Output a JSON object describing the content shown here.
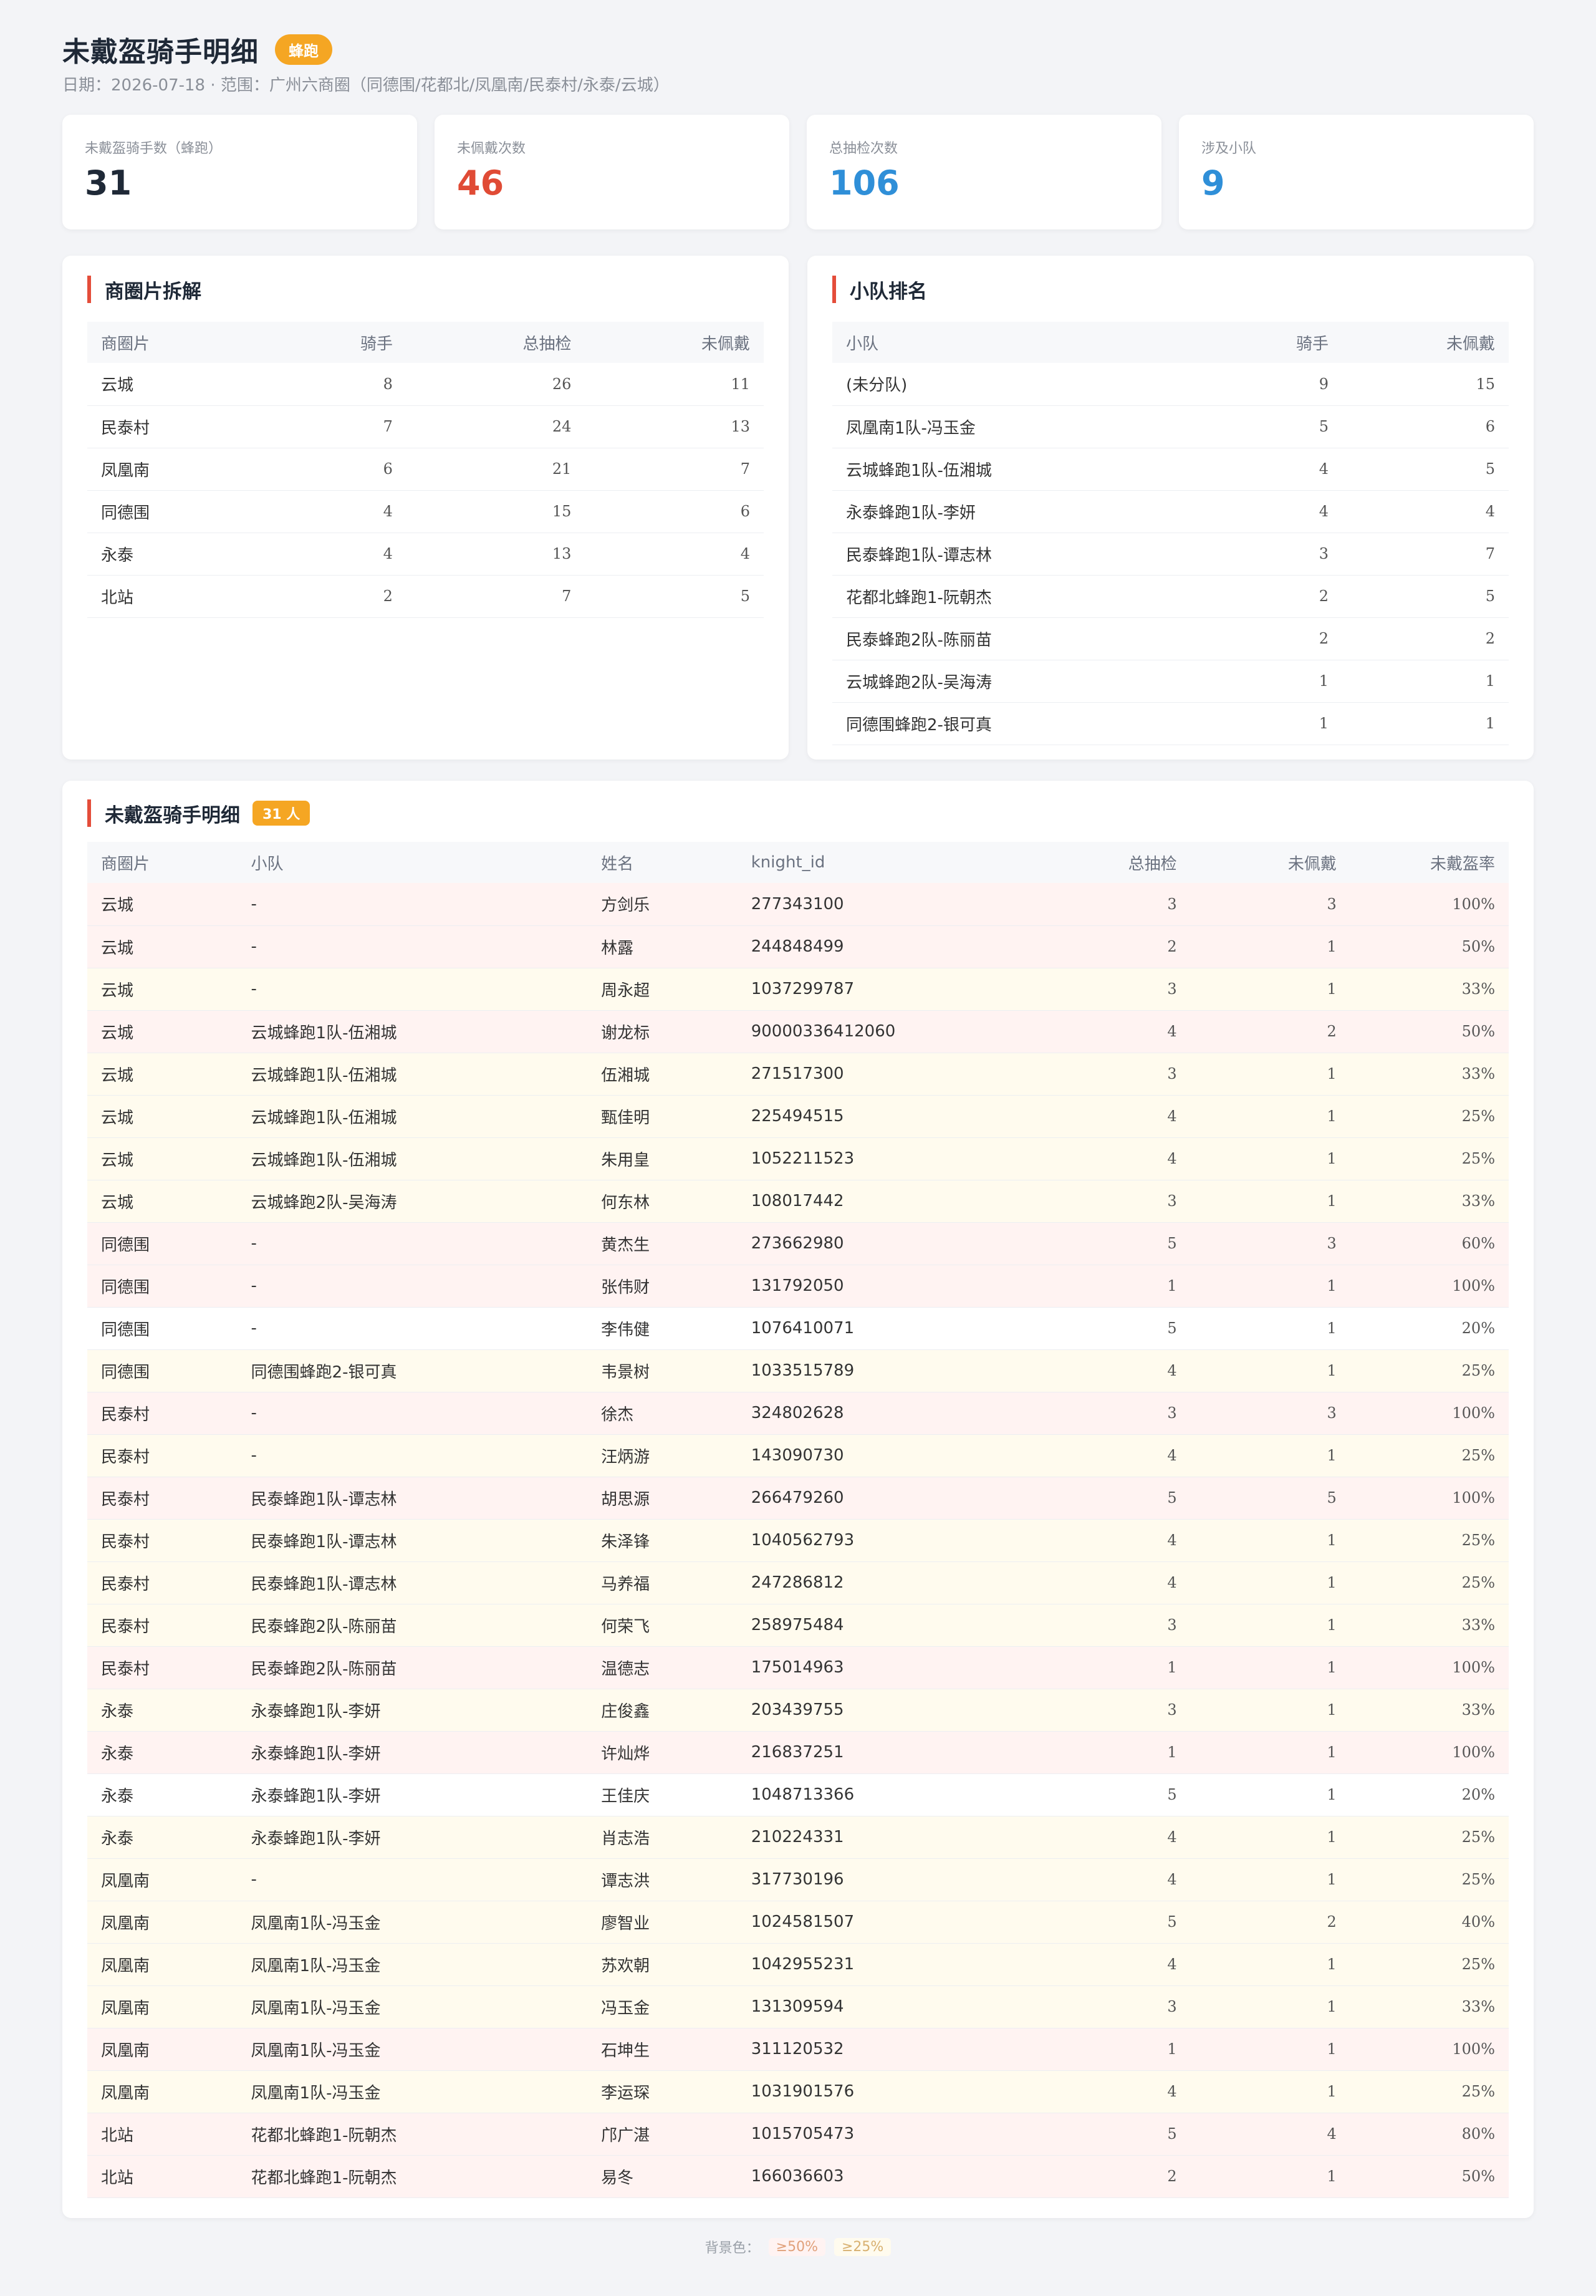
{
  "header": {
    "title": "未戴盔骑手明细",
    "badge": "蜂跑",
    "subtitle": "日期：2026-07-18 · 范围：广州六商圈（同德围/花都北/凤凰南/民泰村/永泰/云城）"
  },
  "stats": [
    {
      "label": "未戴盔骑手数（蜂跑）",
      "value": "31",
      "color": "#1f2937"
    },
    {
      "label": "未佩戴次数",
      "value": "46",
      "color": "#e04b35"
    },
    {
      "label": "总抽检次数",
      "value": "106",
      "color": "#2f8fd8"
    },
    {
      "label": "涉及小队",
      "value": "9",
      "color": "#2f8fd8"
    }
  ],
  "area_breakdown": {
    "title": "商圈片拆解",
    "headers": [
      "商圈片",
      "骑手",
      "总抽检",
      "未佩戴"
    ],
    "rows": [
      [
        "云城",
        "8",
        "26",
        "11"
      ],
      [
        "民泰村",
        "7",
        "24",
        "13"
      ],
      [
        "凤凰南",
        "6",
        "21",
        "7"
      ],
      [
        "同德围",
        "4",
        "15",
        "6"
      ],
      [
        "永泰",
        "4",
        "13",
        "4"
      ],
      [
        "北站",
        "2",
        "7",
        "5"
      ]
    ]
  },
  "team_ranking": {
    "title": "小队排名",
    "headers": [
      "小队",
      "骑手",
      "未佩戴"
    ],
    "rows": [
      [
        "(未分队)",
        "9",
        "15"
      ],
      [
        "凤凰南1队-冯玉金",
        "5",
        "6"
      ],
      [
        "云城蜂跑1队-伍湘城",
        "4",
        "5"
      ],
      [
        "永泰蜂跑1队-李妍",
        "4",
        "4"
      ],
      [
        "民泰蜂跑1队-谭志林",
        "3",
        "7"
      ],
      [
        "花都北蜂跑1-阮朝杰",
        "2",
        "5"
      ],
      [
        "民泰蜂跑2队-陈丽苗",
        "2",
        "2"
      ],
      [
        "云城蜂跑2队-吴海涛",
        "1",
        "1"
      ],
      [
        "同德围蜂跑2-银可真",
        "1",
        "1"
      ]
    ]
  },
  "detail": {
    "title": "未戴盔骑手明细",
    "badge": "31 人",
    "headers": [
      "商圈片",
      "小队",
      "姓名",
      "knight_id",
      "总抽检",
      "未佩戴",
      "未戴盔率"
    ],
    "rows": [
      [
        "云城",
        "-",
        "方剑乐",
        "277343100",
        "3",
        "3",
        "100%"
      ],
      [
        "云城",
        "-",
        "林露",
        "244848499",
        "2",
        "1",
        "50%"
      ],
      [
        "云城",
        "-",
        "周永超",
        "1037299787",
        "3",
        "1",
        "33%"
      ],
      [
        "云城",
        "云城蜂跑1队-伍湘城",
        "谢龙标",
        "90000336412060",
        "4",
        "2",
        "50%"
      ],
      [
        "云城",
        "云城蜂跑1队-伍湘城",
        "伍湘城",
        "271517300",
        "3",
        "1",
        "33%"
      ],
      [
        "云城",
        "云城蜂跑1队-伍湘城",
        "甄佳明",
        "225494515",
        "4",
        "1",
        "25%"
      ],
      [
        "云城",
        "云城蜂跑1队-伍湘城",
        "朱用皇",
        "1052211523",
        "4",
        "1",
        "25%"
      ],
      [
        "云城",
        "云城蜂跑2队-吴海涛",
        "何东林",
        "108017442",
        "3",
        "1",
        "33%"
      ],
      [
        "同德围",
        "-",
        "黄杰生",
        "273662980",
        "5",
        "3",
        "60%"
      ],
      [
        "同德围",
        "-",
        "张伟财",
        "131792050",
        "1",
        "1",
        "100%"
      ],
      [
        "同德围",
        "-",
        "李伟健",
        "1076410071",
        "5",
        "1",
        "20%"
      ],
      [
        "同德围",
        "同德围蜂跑2-银可真",
        "韦景树",
        "1033515789",
        "4",
        "1",
        "25%"
      ],
      [
        "民泰村",
        "-",
        "徐杰",
        "324802628",
        "3",
        "3",
        "100%"
      ],
      [
        "民泰村",
        "-",
        "汪炳游",
        "143090730",
        "4",
        "1",
        "25%"
      ],
      [
        "民泰村",
        "民泰蜂跑1队-谭志林",
        "胡思源",
        "266479260",
        "5",
        "5",
        "100%"
      ],
      [
        "民泰村",
        "民泰蜂跑1队-谭志林",
        "朱泽锋",
        "1040562793",
        "4",
        "1",
        "25%"
      ],
      [
        "民泰村",
        "民泰蜂跑1队-谭志林",
        "马养福",
        "247286812",
        "4",
        "1",
        "25%"
      ],
      [
        "民泰村",
        "民泰蜂跑2队-陈丽苗",
        "何荣飞",
        "258975484",
        "3",
        "1",
        "33%"
      ],
      [
        "民泰村",
        "民泰蜂跑2队-陈丽苗",
        "温德志",
        "175014963",
        "1",
        "1",
        "100%"
      ],
      [
        "永泰",
        "永泰蜂跑1队-李妍",
        "庄俊鑫",
        "203439755",
        "3",
        "1",
        "33%"
      ],
      [
        "永泰",
        "永泰蜂跑1队-李妍",
        "许灿烨",
        "216837251",
        "1",
        "1",
        "100%"
      ],
      [
        "永泰",
        "永泰蜂跑1队-李妍",
        "王佳庆",
        "1048713366",
        "5",
        "1",
        "20%"
      ],
      [
        "永泰",
        "永泰蜂跑1队-李妍",
        "肖志浩",
        "210224331",
        "4",
        "1",
        "25%"
      ],
      [
        "凤凰南",
        "-",
        "谭志洪",
        "317730196",
        "4",
        "1",
        "25%"
      ],
      [
        "凤凰南",
        "凤凰南1队-冯玉金",
        "廖智业",
        "1024581507",
        "5",
        "2",
        "40%"
      ],
      [
        "凤凰南",
        "凤凰南1队-冯玉金",
        "苏欢朝",
        "1042955231",
        "4",
        "1",
        "25%"
      ],
      [
        "凤凰南",
        "凤凰南1队-冯玉金",
        "冯玉金",
        "131309594",
        "3",
        "1",
        "33%"
      ],
      [
        "凤凰南",
        "凤凰南1队-冯玉金",
        "石坤生",
        "311120532",
        "1",
        "1",
        "100%"
      ],
      [
        "凤凰南",
        "凤凰南1队-冯玉金",
        "李运琛",
        "1031901576",
        "4",
        "1",
        "25%"
      ],
      [
        "北站",
        "花都北蜂跑1-阮朝杰",
        "邝广湛",
        "1015705473",
        "5",
        "4",
        "80%"
      ],
      [
        "北站",
        "花都北蜂跑1-阮朝杰",
        "易冬",
        "166036603",
        "2",
        "1",
        "50%"
      ]
    ]
  },
  "legend": {
    "label": "背景色：",
    "high": "≥50%",
    "mid": "≥25%",
    "colors": {
      "high": "#fff3f2",
      "mid": "#fffbee"
    }
  }
}
